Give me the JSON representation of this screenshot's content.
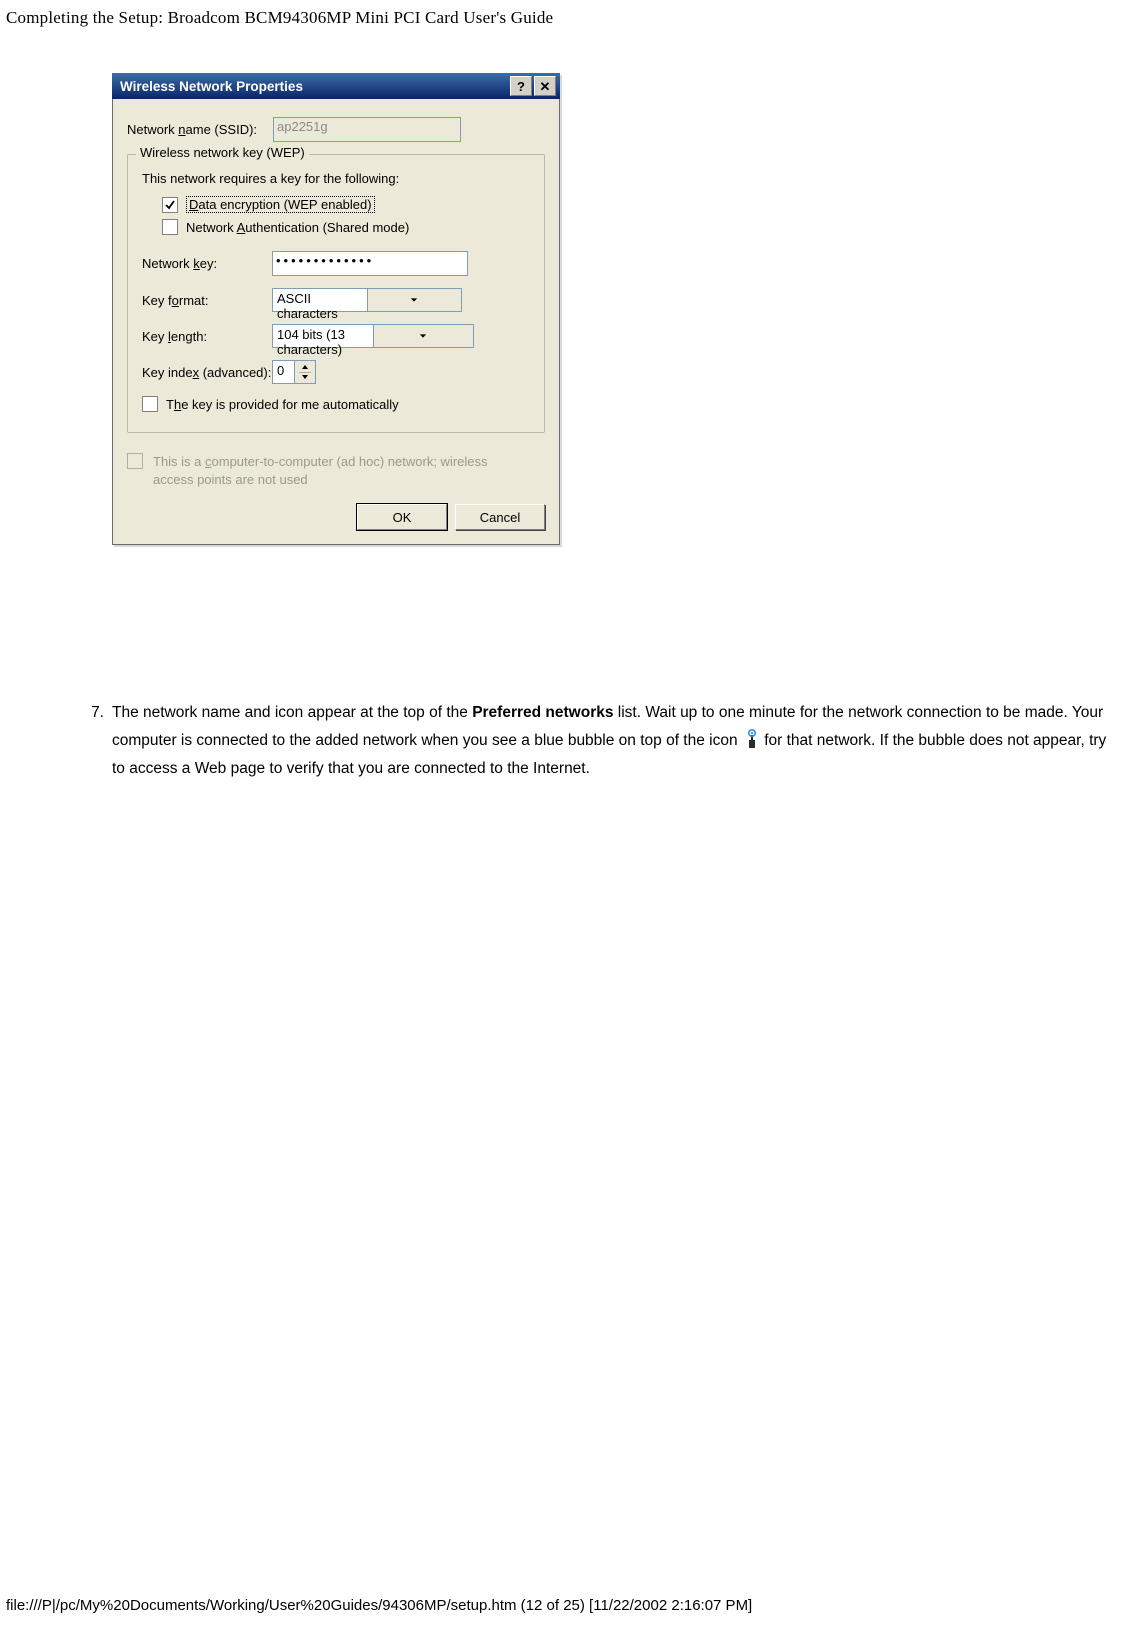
{
  "doc_header": "Completing the Setup: Broadcom BCM94306MP Mini PCI Card User's Guide",
  "doc_footer": "file:///P|/pc/My%20Documents/Working/User%20Guides/94306MP/setup.htm (12 of 25) [11/22/2002 2:16:07 PM]",
  "instruction": {
    "number": "7.",
    "text_before_bold": "The network name and icon appear at the top of the ",
    "bold": "Preferred networks",
    "text_after_bold": " list. Wait up to one minute for the network connection to be made. Your computer is connected to the added network when you see a blue bubble on top of the icon ",
    "text_tail": " for that network. If the bubble does not appear, try to access a Web page to verify that you are connected to the Internet."
  },
  "dialog": {
    "title": "Wireless Network Properties",
    "help_btn": "?",
    "close_btn": "✕",
    "ssid_label_pre": "Network ",
    "ssid_label_u": "n",
    "ssid_label_post": "ame (SSID):",
    "ssid_value": "ap2251g",
    "wep_legend": "Wireless network key (WEP)",
    "wep_intro": "This network requires a key for the following:",
    "chk_encrypt_u": "D",
    "chk_encrypt": "ata encryption (WEP enabled)",
    "chk_auth_pre": "Network ",
    "chk_auth_u": "A",
    "chk_auth_post": "uthentication (Shared mode)",
    "key_label_pre": "Network ",
    "key_label_u": "k",
    "key_label_post": "ey:",
    "key_value": "•••••••••••••",
    "format_label_pre": "Key f",
    "format_label_u": "o",
    "format_label_post": "rmat:",
    "format_value": "ASCII characters",
    "length_label_pre": "Key ",
    "length_label_u": "l",
    "length_label_post": "ength:",
    "length_value": "104 bits (13 characters)",
    "index_label_pre": "Key inde",
    "index_label_u": "x",
    "index_label_post": " (advanced):",
    "index_value": "0",
    "auto_pre": "T",
    "auto_u": "h",
    "auto_post": "e key is provided for me automatically",
    "adhoc_pre": "This is a ",
    "adhoc_u": "c",
    "adhoc_post": "omputer-to-computer (ad hoc) network; wireless access points are not used",
    "ok": "OK",
    "cancel": "Cancel"
  }
}
